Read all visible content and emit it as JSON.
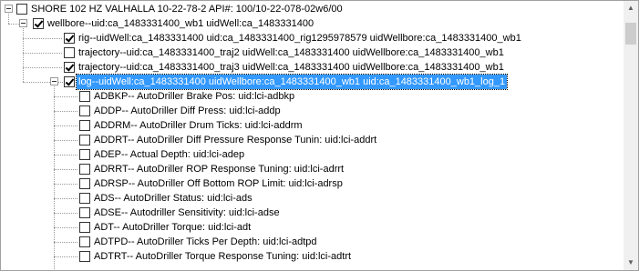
{
  "root": {
    "label": "SHORE 102 HZ VALHALLA 10-22-78-2 API#: 100/10-22-078-02w6/00",
    "checked": false
  },
  "wellbore": {
    "label": "wellbore--uid:ca_1483331400_wb1 uidWell:ca_1483331400",
    "checked": true
  },
  "wellbore_children": [
    {
      "label": "rig--uidWell:ca_1483331400 uid:ca_1483331400_rig1295978579 uidWellbore:ca_1483331400_wb1",
      "checked": true
    },
    {
      "label": "trajectory--uid:ca_1483331400_traj2 uidWell:ca_1483331400 uidWellbore:ca_1483331400_wb1",
      "checked": false
    },
    {
      "label": "trajectory--uid:ca_1483331400_traj3 uidWell:ca_1483331400 uidWellbore:ca_1483331400_wb1",
      "checked": true
    }
  ],
  "log": {
    "label": "log--uidWell:ca_1483331400 uidWellbore:ca_1483331400_wb1 uid:ca_1483331400_wb1_log_1",
    "checked": true,
    "selected": true
  },
  "curves": [
    {
      "label": "ADBKP-- AutoDriller Brake Pos: uid:lci-adbkp",
      "checked": false
    },
    {
      "label": "ADDP-- AutoDriller Diff Press: uid:lci-addp",
      "checked": false
    },
    {
      "label": "ADDRM-- AutoDriller Drum Ticks: uid:lci-addrm",
      "checked": false
    },
    {
      "label": "ADDRT-- AutoDriller Diff Pressure Response Tunin: uid:lci-addrt",
      "checked": false
    },
    {
      "label": "ADEP-- Actual Depth: uid:lci-adep",
      "checked": false
    },
    {
      "label": "ADRRT-- AutoDriller ROP Response Tuning: uid:lci-adrrt",
      "checked": false
    },
    {
      "label": "ADRSP-- AutoDriller Off Bottom ROP Limit: uid:lci-adrsp",
      "checked": false
    },
    {
      "label": "ADS-- AutoDriller Status: uid:lci-ads",
      "checked": false
    },
    {
      "label": "ADSE-- Autodriller Sensitivity: uid:lci-adse",
      "checked": false
    },
    {
      "label": "ADT-- AutoDriller Torque: uid:lci-adt",
      "checked": false
    },
    {
      "label": "ADTPD-- AutoDriller Ticks Per Depth: uid:lci-adtpd",
      "checked": false
    },
    {
      "label": "ADTRT-- AutoDriller Torque Response Tuning: uid:lci-adtrt",
      "checked": false
    }
  ],
  "scrollbar": {
    "up_arrow": "▲",
    "down_arrow": "▼",
    "position": 0.05
  }
}
